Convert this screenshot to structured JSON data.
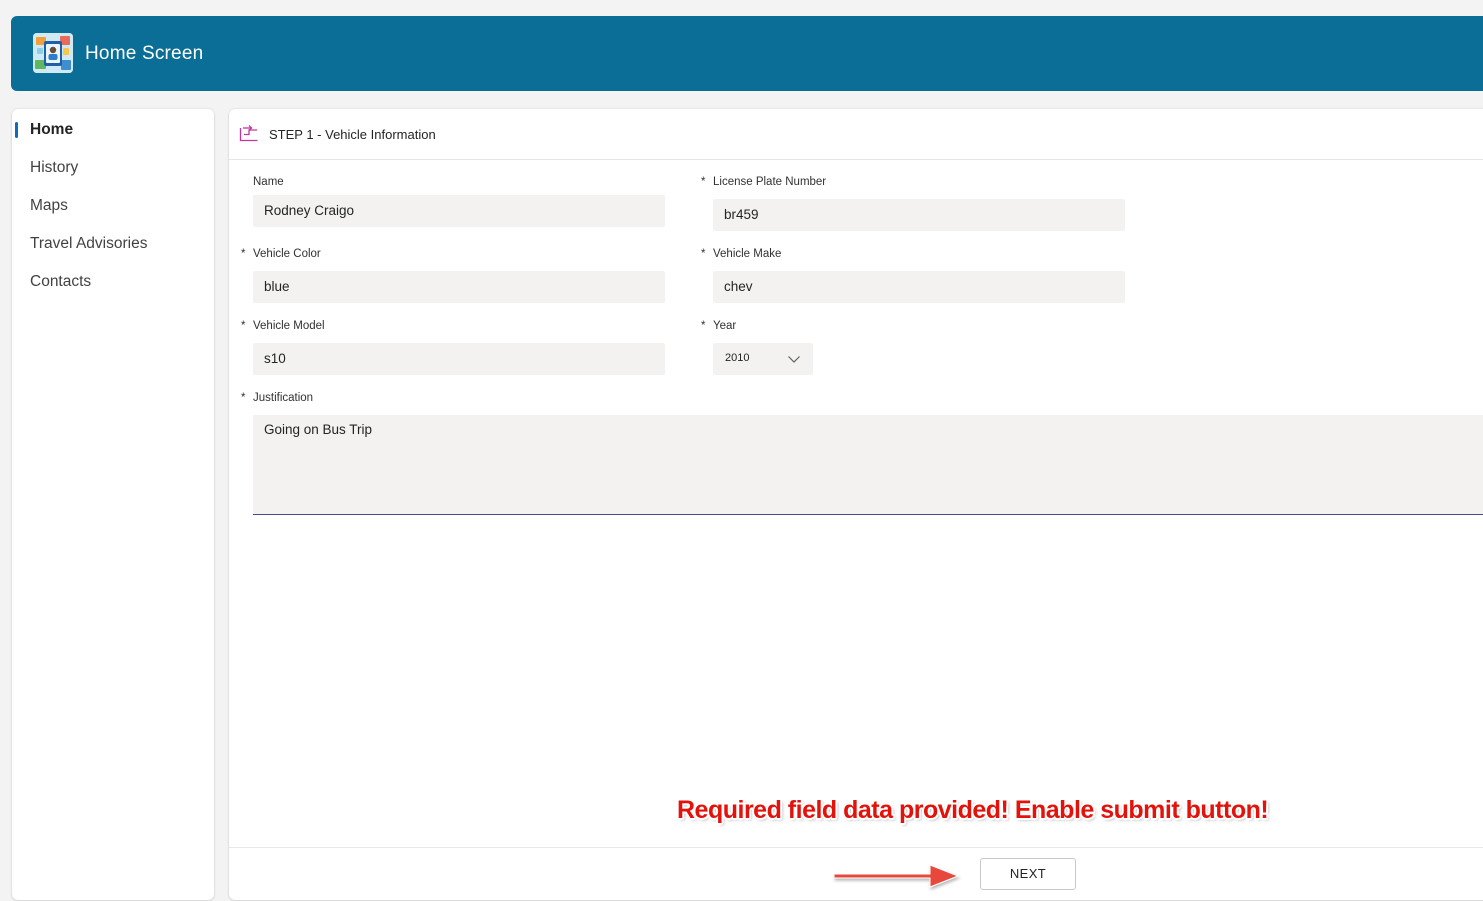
{
  "header": {
    "title": "Home Screen",
    "logo_icon": "app-logo-icon",
    "background": "#0b6e96"
  },
  "sidebar": {
    "items": [
      {
        "label": "Home",
        "active": true
      },
      {
        "label": "History",
        "active": false
      },
      {
        "label": "Maps",
        "active": false
      },
      {
        "label": "Travel Advisories",
        "active": false
      },
      {
        "label": "Contacts",
        "active": false
      }
    ],
    "accent": "#0f6cbd"
  },
  "form": {
    "step_icon": "step-flow-icon",
    "step_title": "STEP 1 - Vehicle Information",
    "required_marker": "*",
    "fields": {
      "name": {
        "label": "Name",
        "value": "Rodney Craigo",
        "required": false
      },
      "license_plate": {
        "label": "License Plate Number",
        "value": "br459",
        "required": true
      },
      "vehicle_color": {
        "label": "Vehicle Color",
        "value": "blue",
        "required": true
      },
      "vehicle_make": {
        "label": "Vehicle Make",
        "value": "chev",
        "required": true
      },
      "vehicle_model": {
        "label": "Vehicle Model",
        "value": "s10",
        "required": true
      },
      "year": {
        "label": "Year",
        "value": "2010",
        "required": true
      },
      "justification": {
        "label": "Justification",
        "value": "Going on Bus Trip",
        "required": true
      }
    },
    "next_button": "NEXT"
  },
  "annotation": {
    "text": "Required field data  provided! Enable submit button!",
    "color": "#e3120b",
    "arrow_color": "#e8463a"
  }
}
